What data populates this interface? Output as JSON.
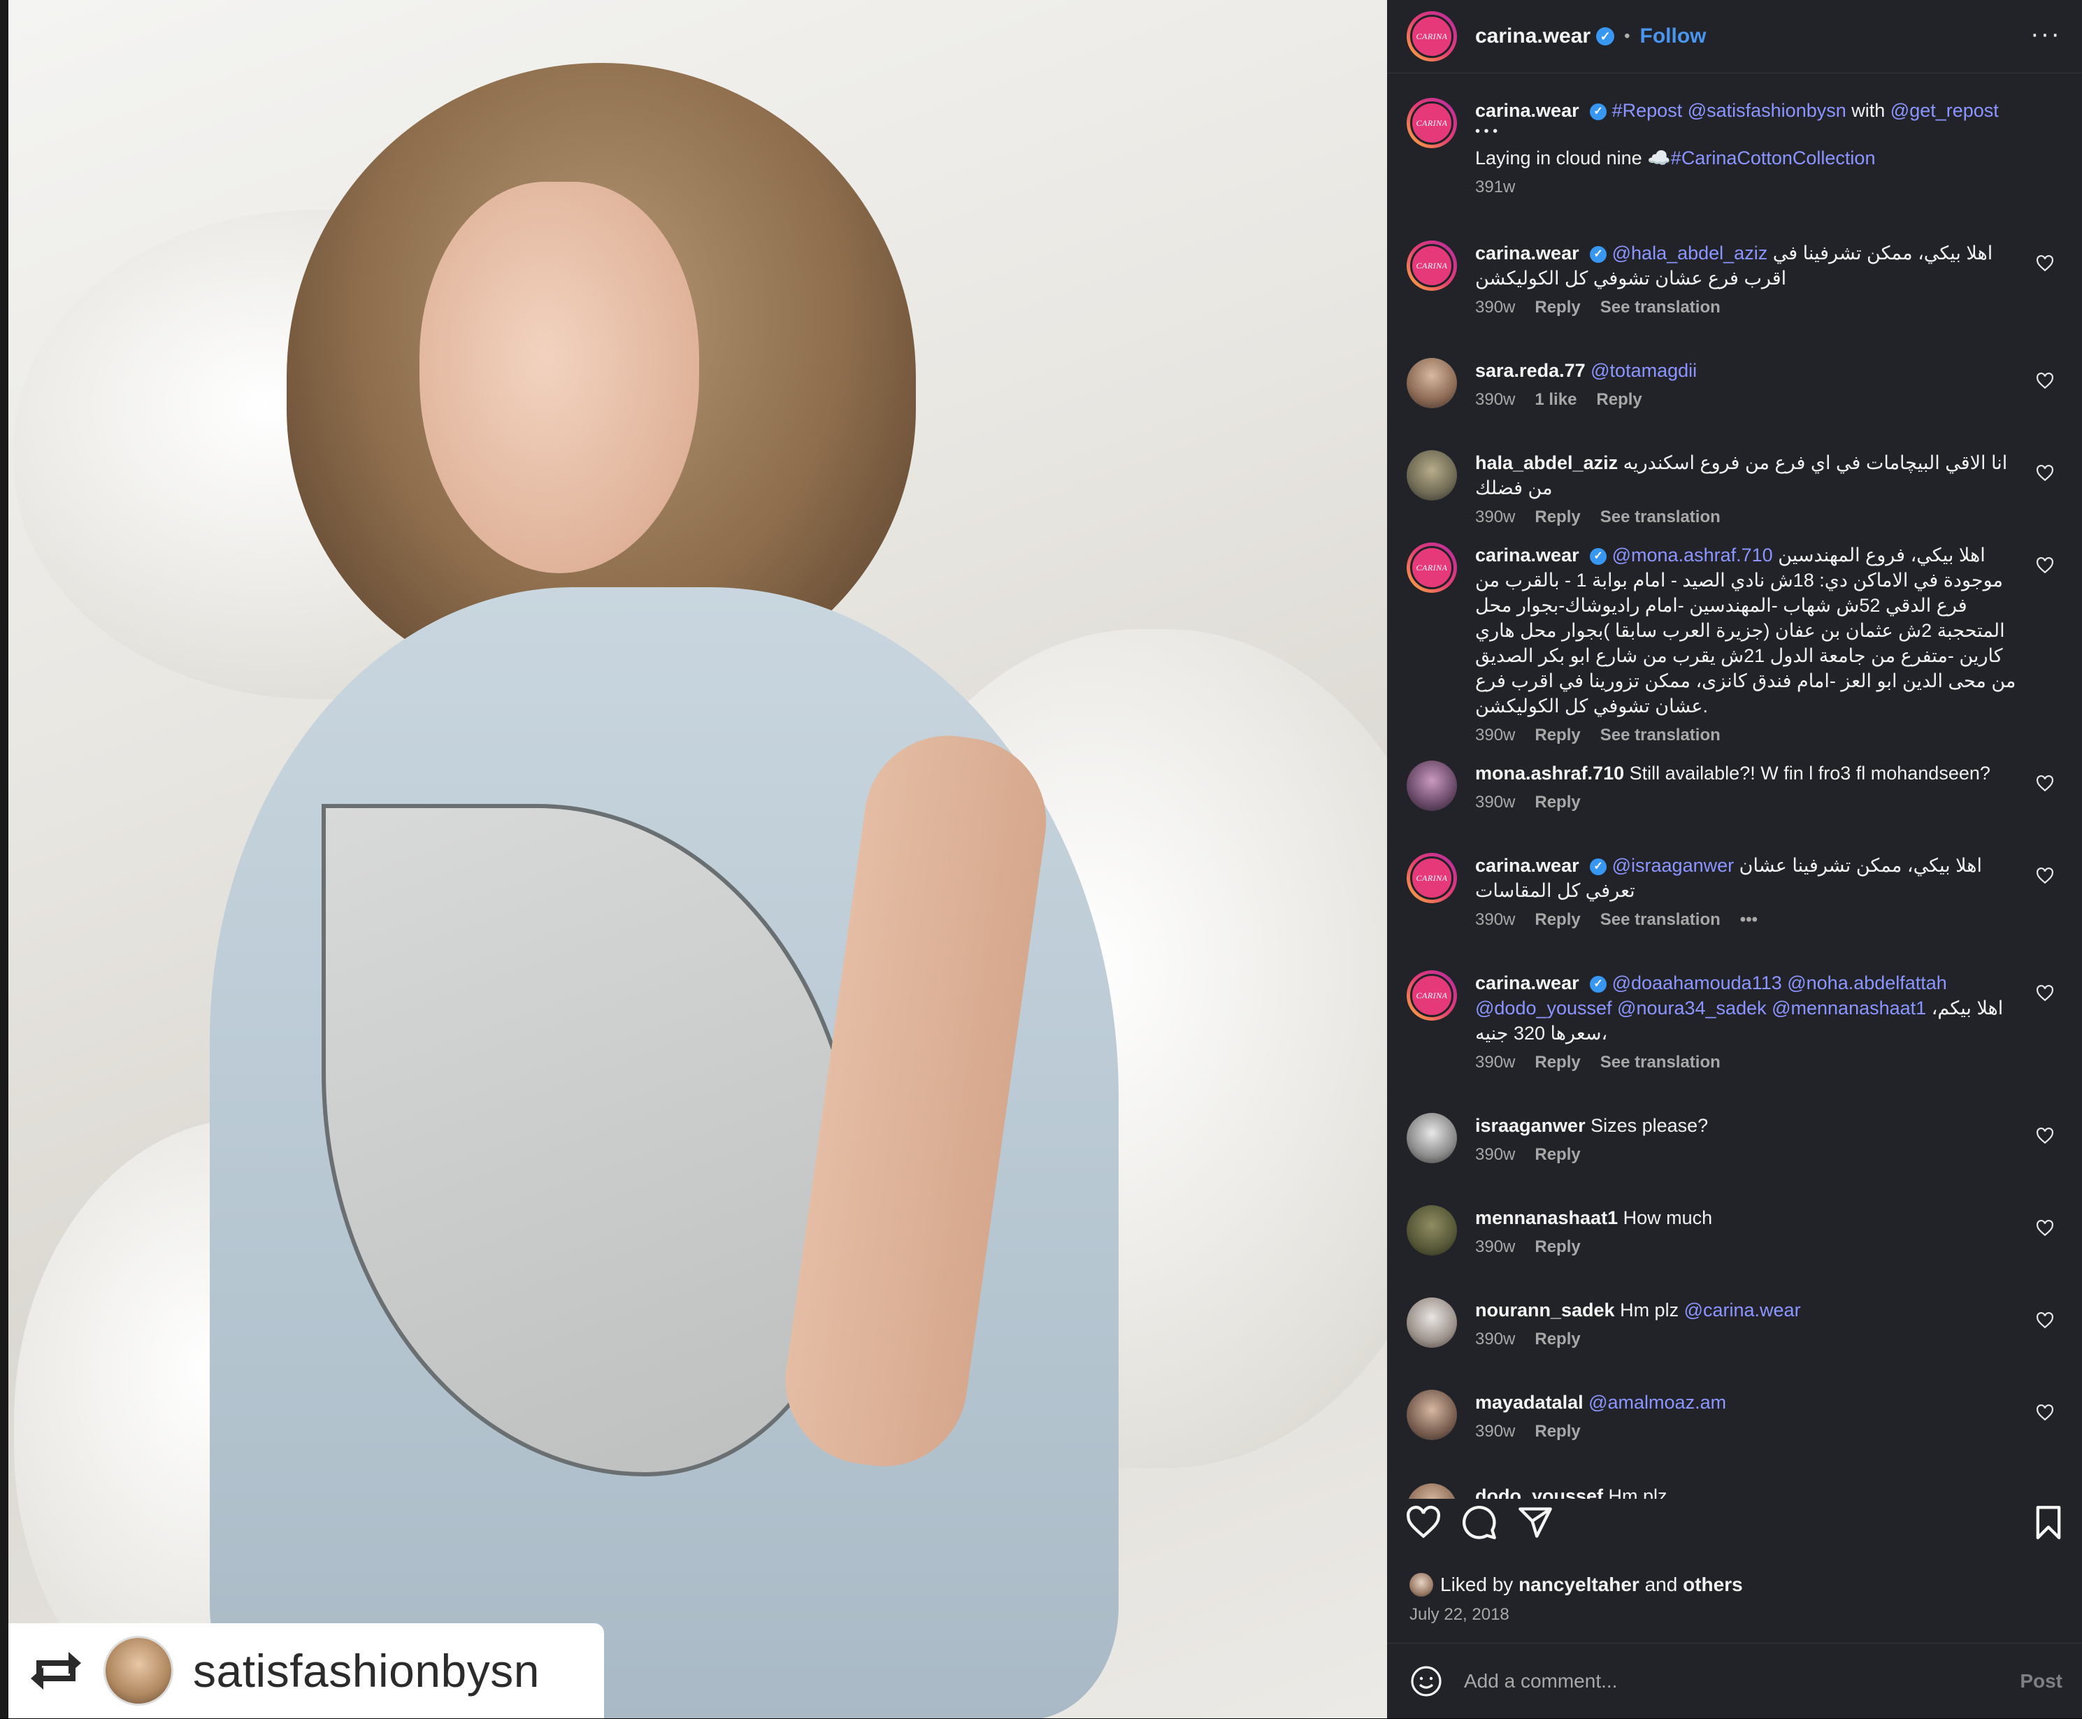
{
  "repost_badge": {
    "username": "satisfashionbysn"
  },
  "header": {
    "username": "carina.wear",
    "follow_label": "Follow",
    "separator": "•",
    "more": "···",
    "logo_text": "CARINA"
  },
  "caption": {
    "username": "carina.wear",
    "line1_pre": "#Repost",
    "line1_mention": "@satisfashionbysn",
    "line1_with": "with",
    "line1_mention2": "@get_repost",
    "dots": "• • •",
    "line2": "Laying in cloud nine ☁️",
    "line2_tag": "#CarinaCottonCollection",
    "time": "391w"
  },
  "comments": [
    {
      "user": "carina.wear",
      "mention": "@hala_abdel_aziz",
      "text": " اهلا بيكي، ممكن تشرفينا في اقرب فرع عشان تشوفي كل الكوليكشن",
      "time": "390w",
      "likes": "",
      "reply": "Reply",
      "translate": "See translation"
    },
    {
      "user": "sara.reda.77",
      "mention": "@totamagdii",
      "text": "",
      "time": "390w",
      "likes": "1 like",
      "reply": "Reply",
      "translate": ""
    },
    {
      "user": "hala_abdel_aziz",
      "mention": "",
      "text": " انا الاقي البيچامات في اي فرع من فروع اسكندريه من فضلك",
      "time": "390w",
      "likes": "",
      "reply": "Reply",
      "translate": "See translation"
    },
    {
      "user": "carina.wear",
      "mention": "@mona.ashraf.710",
      "text": " اهلا بيكي، فروع المهندسين موجودة في الاماكن دي: 18ش نادي الصيد - امام بوابة 1 - بالقرب من فرع الدقي 52ش شهاب -المهندسين -امام راديوشاك-بجوار محل المتحجبة 2ش عثمان بن عفان (جزيرة العرب سابقا )بجوار محل هاري كارين -متفرع من جامعة الدول 21ش يقرب من شارع ابو بكر الصديق من محى الدين ابو العز -امام فندق كانزى، ممكن تزورينا في اقرب فرع عشان تشوفي كل الكوليكشن.",
      "time": "390w",
      "likes": "",
      "reply": "Reply",
      "translate": "See translation"
    },
    {
      "user": "mona.ashraf.710",
      "mention": "",
      "text": " Still available?! W fin l fro3 fl mohandseen?",
      "time": "390w",
      "likes": "",
      "reply": "Reply",
      "translate": ""
    },
    {
      "user": "carina.wear",
      "mention": "@israaganwer",
      "text": " اهلا بيكي، ممكن تشرفينا عشان تعرفي كل المقاسات",
      "time": "390w",
      "likes": "",
      "reply": "Reply",
      "translate": "See translation",
      "more": "•••"
    },
    {
      "user": "carina.wear",
      "mention": "@doaahamouda113 @noha.abdelfattah @dodo_youssef @noura34_sadek @mennanashaat1",
      "text": " اهلا بيكم، سعرها 320 جنيه،",
      "time": "390w",
      "likes": "",
      "reply": "Reply",
      "translate": "See translation"
    },
    {
      "user": "israaganwer",
      "mention": "",
      "text": " Sizes please?",
      "time": "390w",
      "likes": "",
      "reply": "Reply",
      "translate": ""
    },
    {
      "user": "mennanashaat1",
      "mention": "",
      "text": " How much",
      "time": "390w",
      "likes": "",
      "reply": "Reply",
      "translate": ""
    },
    {
      "user": "nourann_sadek",
      "mention": "@carina.wear",
      "text": " Hm plz",
      "time": "390w",
      "likes": "",
      "reply": "Reply",
      "translate": ""
    },
    {
      "user": "mayadatalal",
      "mention": "@amalmoaz.am",
      "text": "",
      "time": "390w",
      "likes": "",
      "reply": "Reply",
      "translate": ""
    },
    {
      "user": "dodo_youssef",
      "mention": "",
      "text": " Hm plz",
      "time": "",
      "likes": "",
      "reply": "",
      "translate": ""
    }
  ],
  "footer": {
    "liked_by": "Liked by",
    "liked_user": "nancyeltaher",
    "and": "and",
    "others": "others",
    "date": "July 22, 2018",
    "comment_placeholder": "Add a comment...",
    "post_label": "Post"
  }
}
